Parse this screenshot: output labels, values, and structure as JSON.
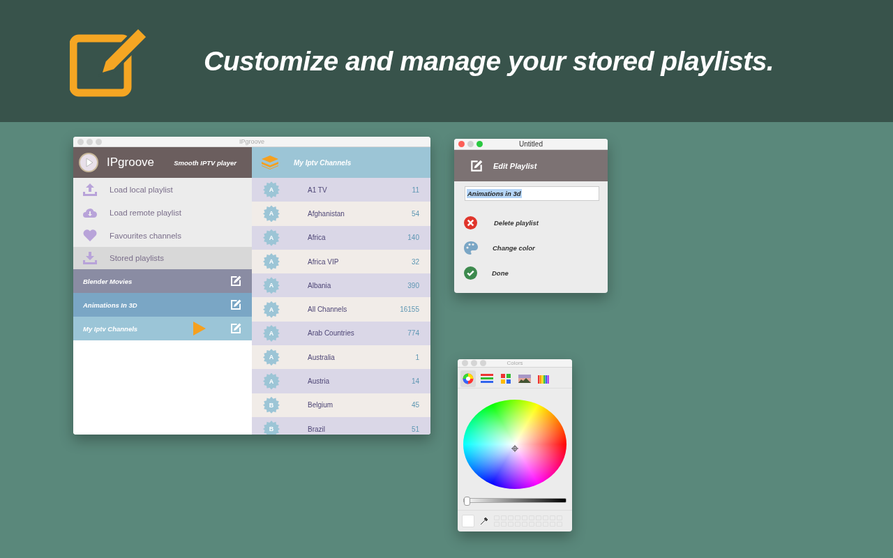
{
  "banner": {
    "headline": "Customize and manage your stored playlists."
  },
  "main_window": {
    "title": "IPgroove",
    "app_name": "IPgroove",
    "tagline": "Smooth IPTV player",
    "menu": [
      {
        "kind": "upload",
        "label": "Load local playlist",
        "selected": false
      },
      {
        "kind": "cloud",
        "label": "Load remote playlist",
        "selected": false
      },
      {
        "kind": "heart",
        "label": "Favourites channels",
        "selected": false
      },
      {
        "kind": "download",
        "label": "Stored playlists",
        "selected": true
      }
    ],
    "playlists": [
      {
        "name": "Blender Movies",
        "color": "#8a8ca3",
        "playing": false
      },
      {
        "name": "Animations In 3D",
        "color": "#7aa6c5",
        "playing": false
      },
      {
        "name": "My Iptv Channels",
        "color": "#9bc5d7",
        "playing": true
      }
    ],
    "channel_list": {
      "title": "My Iptv Channels",
      "rows": [
        {
          "letter": "A",
          "name": "A1 TV",
          "count": "11"
        },
        {
          "letter": "A",
          "name": "Afghanistan",
          "count": "54"
        },
        {
          "letter": "A",
          "name": "Africa",
          "count": "140"
        },
        {
          "letter": "A",
          "name": "Africa VIP",
          "count": "32"
        },
        {
          "letter": "A",
          "name": "Albania",
          "count": "390"
        },
        {
          "letter": "A",
          "name": "All Channels",
          "count": "16155"
        },
        {
          "letter": "A",
          "name": "Arab Countries",
          "count": "774"
        },
        {
          "letter": "A",
          "name": "Australia",
          "count": "1"
        },
        {
          "letter": "A",
          "name": "Austria",
          "count": "14"
        },
        {
          "letter": "B",
          "name": "Belgium",
          "count": "45"
        },
        {
          "letter": "B",
          "name": "Brazil",
          "count": "51"
        }
      ]
    }
  },
  "edit_window": {
    "title": "Untitled",
    "heading": "Edit Playlist",
    "name_value": "Animations in 3d",
    "actions": [
      {
        "kind": "delete",
        "label": "Delete playlist"
      },
      {
        "kind": "color",
        "label": "Change color"
      },
      {
        "kind": "done",
        "label": "Done"
      }
    ]
  },
  "colors_window": {
    "title": "Colors",
    "tabs": [
      {
        "kind": "wheel",
        "selected": true
      },
      {
        "kind": "sliders",
        "selected": false
      },
      {
        "kind": "palettes",
        "selected": false
      },
      {
        "kind": "image",
        "selected": false
      },
      {
        "kind": "pencils",
        "selected": false
      }
    ],
    "brightness": {
      "level": 0
    }
  }
}
